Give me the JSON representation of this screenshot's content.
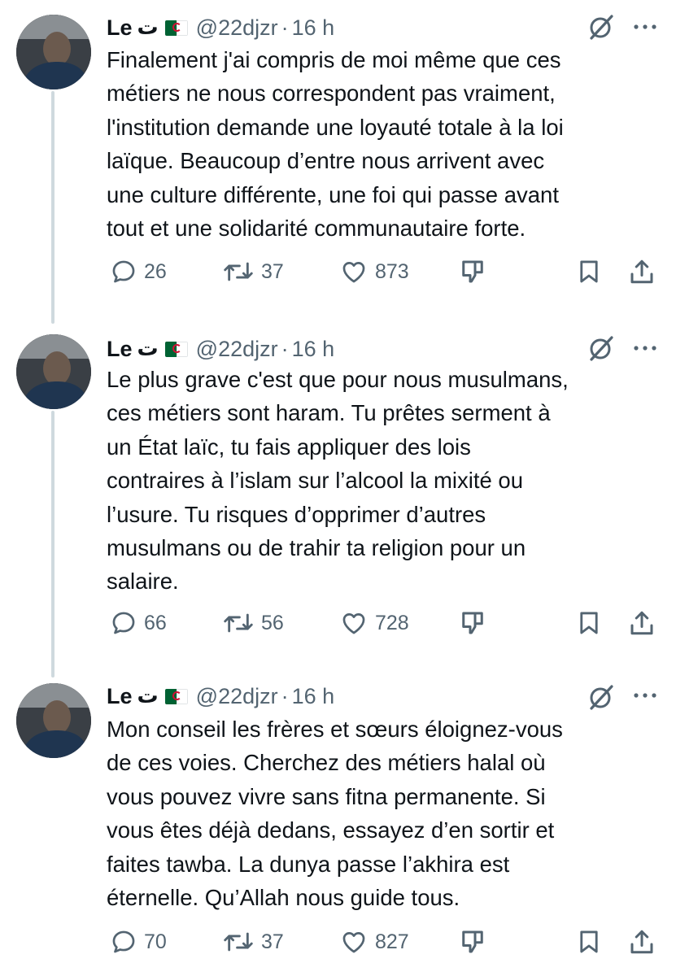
{
  "tweets": [
    {
      "author_name": "Le",
      "author_arabic": "ت",
      "handle": "@22djzr",
      "separator": "·",
      "time": "16 h",
      "text_lines": [
        "Finalement j'ai compris de moi même que ces",
        "métiers ne nous correspondent pas vraiment,",
        "l'institution demande une loyauté totale à la loi",
        "laïque. Beaucoup d’entre nous arrivent avec",
        "une culture différente, une foi qui passe avant",
        "tout et une solidarité communautaire forte."
      ],
      "replies": "26",
      "reposts": "37",
      "likes": "873"
    },
    {
      "author_name": "Le",
      "author_arabic": "ت",
      "handle": "@22djzr",
      "separator": "·",
      "time": "16 h",
      "text_lines": [
        "Le plus grave c'est que pour nous musulmans,",
        "ces métiers sont haram. Tu prêtes serment à",
        "un État laïc, tu fais appliquer des lois",
        "contraires à l’islam sur l’alcool la mixité ou",
        "l’usure. Tu risques d’opprimer d’autres",
        "musulmans ou de trahir ta religion pour un",
        "salaire."
      ],
      "replies": "66",
      "reposts": "56",
      "likes": "728"
    },
    {
      "author_name": "Le",
      "author_arabic": "ت",
      "handle": "@22djzr",
      "separator": "·",
      "time": "16 h",
      "text_lines": [
        "Mon conseil les frères et sœurs éloignez-vous",
        "de ces voies. Cherchez des métiers halal où",
        "vous pouvez vivre sans fitna permanente. Si",
        "vous êtes déjà dedans, essayez d’en sortir et",
        "faites tawba. La dunya passe l’akhira est",
        "éternelle. Qu’Allah nous guide tous."
      ],
      "replies": "70",
      "reposts": "37",
      "likes": "827"
    }
  ],
  "icons": {
    "reply": "reply-icon",
    "repost": "repost-icon",
    "like": "like-icon",
    "stats": "stats-icon",
    "bookmark": "bookmark-icon",
    "share": "share-icon",
    "grok": "grok-icon",
    "more": "more-icon",
    "flag": "algeria-flag-icon"
  },
  "colors": {
    "text": "#0f1419",
    "secondary": "#536471",
    "thread_line": "#cfd9de",
    "flag_green": "#006233",
    "flag_red": "#d21034"
  }
}
